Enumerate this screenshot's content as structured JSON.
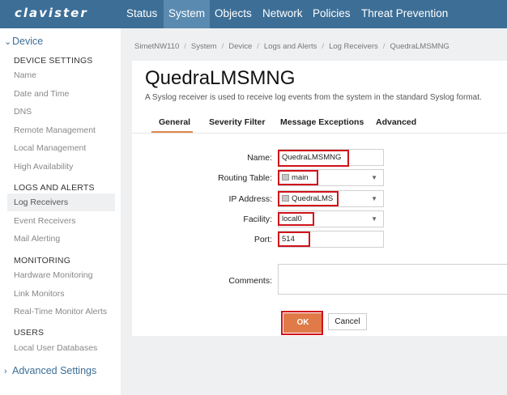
{
  "header": {
    "logo": "clavister",
    "nav": [
      "Status",
      "System",
      "Objects",
      "Network",
      "Policies",
      "Threat Prevention"
    ],
    "active_nav": "System"
  },
  "sidebar": {
    "device_label": "Device",
    "groups": [
      {
        "heading": "DEVICE SETTINGS",
        "items": [
          "Name",
          "Date and Time",
          "DNS",
          "Remote Management",
          "Local Management",
          "High Availability"
        ]
      },
      {
        "heading": "LOGS AND ALERTS",
        "items": [
          "Log Receivers",
          "Event Receivers",
          "Mail Alerting"
        ]
      },
      {
        "heading": "MONITORING",
        "items": [
          "Hardware Monitoring",
          "Link Monitors",
          "Real-Time Monitor Alerts"
        ]
      },
      {
        "heading": "USERS",
        "items": [
          "Local User Databases"
        ]
      }
    ],
    "active_item": "Log Receivers",
    "advanced_label": "Advanced Settings"
  },
  "breadcrumb": [
    "SimetNW110",
    "System",
    "Device",
    "Logs and Alerts",
    "Log Receivers",
    "QuedraLMSMNG"
  ],
  "page": {
    "title": "QuedraLMSMNG",
    "description": "A Syslog receiver is used to receive log events from the system in the standard Syslog format."
  },
  "tabs": [
    "General",
    "Severity Filter",
    "Message Exceptions",
    "Advanced"
  ],
  "active_tab": "General",
  "form": {
    "name_label": "Name:",
    "name_value": "QuedraLMSMNG",
    "routing_label": "Routing Table:",
    "routing_value": "main",
    "ip_label": "IP Address:",
    "ip_value": "QuedraLMS",
    "facility_label": "Facility:",
    "facility_value": "local0",
    "port_label": "Port:",
    "port_value": "514",
    "comments_label": "Comments:",
    "comments_value": ""
  },
  "buttons": {
    "ok": "OK",
    "cancel": "Cancel"
  },
  "colors": {
    "topbar": "#3c6e96",
    "accent": "#e07a48",
    "highlight": "#d0121b"
  }
}
